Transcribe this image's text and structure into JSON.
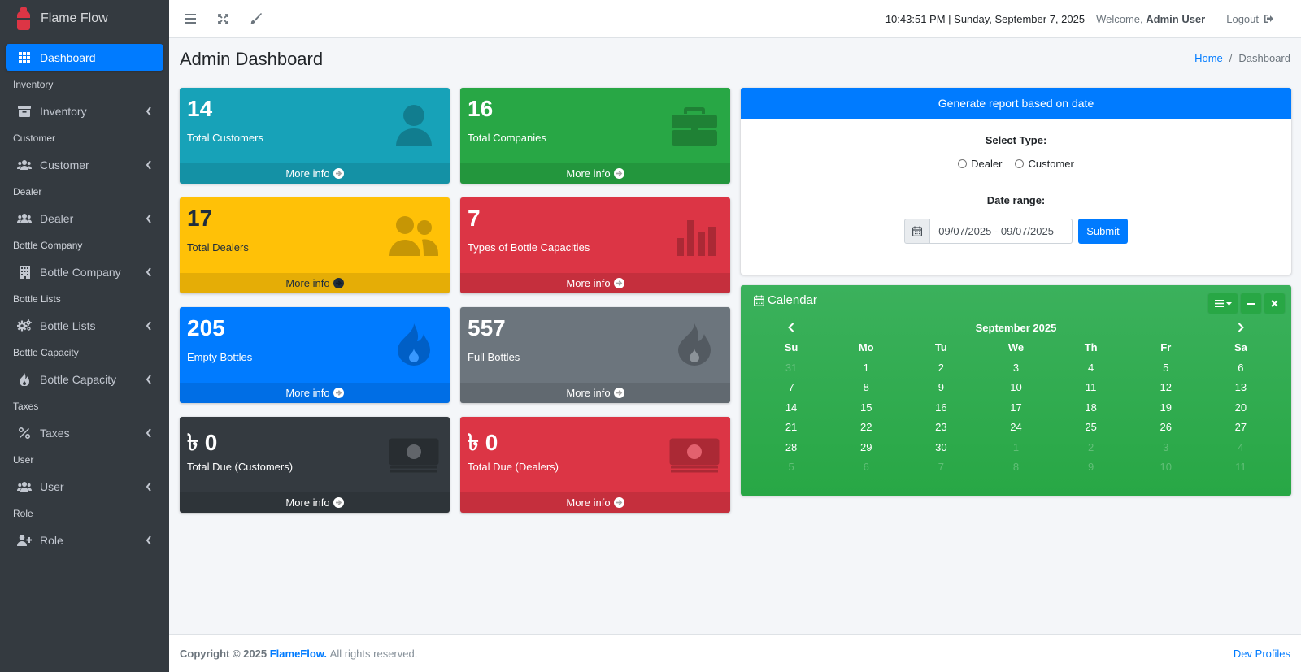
{
  "app": {
    "name": "Flame Flow"
  },
  "sidebar": {
    "active": {
      "label": "Dashboard"
    },
    "sections": [
      {
        "header": "Inventory",
        "label": "Inventory",
        "icon": "archive-icon"
      },
      {
        "header": "Customer",
        "label": "Customer",
        "icon": "users-icon"
      },
      {
        "header": "Dealer",
        "label": "Dealer",
        "icon": "users-icon"
      },
      {
        "header": "Bottle Company",
        "label": "Bottle Company",
        "icon": "building-icon"
      },
      {
        "header": "Bottle Lists",
        "label": "Bottle Lists",
        "icon": "cogs-icon"
      },
      {
        "header": "Bottle Capacity",
        "label": "Bottle Capacity",
        "icon": "fire-icon"
      },
      {
        "header": "Taxes",
        "label": "Taxes",
        "icon": "percent-icon"
      },
      {
        "header": "User",
        "label": "User",
        "icon": "users-icon"
      },
      {
        "header": "Role",
        "label": "Role",
        "icon": "user-plus-icon"
      }
    ]
  },
  "topbar": {
    "datetime": "10:43:51 PM | Sunday, September 7, 2025",
    "welcome_prefix": "Welcome,",
    "welcome_user": "Admin User",
    "logout": "Logout"
  },
  "page": {
    "title": "Admin Dashboard",
    "breadcrumb": {
      "home": "Home",
      "sep": "/",
      "current": "Dashboard"
    }
  },
  "boxes": [
    {
      "value": "14",
      "label": "Total Customers",
      "more": "More info",
      "color": "#17a2b8",
      "icon": "user-icon"
    },
    {
      "value": "16",
      "label": "Total Companies",
      "more": "More info",
      "color": "#28a745",
      "icon": "briefcase-icon"
    },
    {
      "value": "17",
      "label": "Total Dealers",
      "more": "More info",
      "color": "#ffc107",
      "icon": "user-friends-icon"
    },
    {
      "value": "7",
      "label": "Types of Bottle Capacities",
      "more": "More info",
      "color": "#dc3545",
      "icon": "bar-chart-icon"
    },
    {
      "value": "205",
      "label": "Empty Bottles",
      "more": "More info",
      "color": "#007bff",
      "icon": "fire-icon"
    },
    {
      "value": "557",
      "label": "Full Bottles",
      "more": "More info",
      "color": "#6c757d",
      "icon": "fire-icon"
    },
    {
      "value": "৳ 0",
      "label": "Total Due (Customers)",
      "more": "More info",
      "color": "#343a40",
      "icon": "money-bill-icon"
    },
    {
      "value": "৳ 0",
      "label": "Total Due (Dealers)",
      "more": "More info",
      "color": "#dc3545",
      "icon": "money-bill-icon"
    }
  ],
  "report": {
    "title": "Generate report based on date",
    "select_type": "Select Type:",
    "options": [
      "Dealer",
      "Customer"
    ],
    "date_range_label": "Date range:",
    "date_range_value": "09/07/2025 - 09/07/2025",
    "submit": "Submit"
  },
  "calendar": {
    "title": "Calendar",
    "month": "September 2025",
    "weekdays": [
      "Su",
      "Mo",
      "Tu",
      "We",
      "Th",
      "Fr",
      "Sa"
    ],
    "weeks": [
      [
        [
          "31",
          1
        ],
        [
          "1",
          0
        ],
        [
          "2",
          0
        ],
        [
          "3",
          0
        ],
        [
          "4",
          0
        ],
        [
          "5",
          0
        ],
        [
          "6",
          0
        ]
      ],
      [
        [
          "7",
          0
        ],
        [
          "8",
          0
        ],
        [
          "9",
          0
        ],
        [
          "10",
          0
        ],
        [
          "11",
          0
        ],
        [
          "12",
          0
        ],
        [
          "13",
          0
        ]
      ],
      [
        [
          "14",
          0
        ],
        [
          "15",
          0
        ],
        [
          "16",
          0
        ],
        [
          "17",
          0
        ],
        [
          "18",
          0
        ],
        [
          "19",
          0
        ],
        [
          "20",
          0
        ]
      ],
      [
        [
          "21",
          0
        ],
        [
          "22",
          0
        ],
        [
          "23",
          0
        ],
        [
          "24",
          0
        ],
        [
          "25",
          0
        ],
        [
          "26",
          0
        ],
        [
          "27",
          0
        ]
      ],
      [
        [
          "28",
          0
        ],
        [
          "29",
          0
        ],
        [
          "30",
          0
        ],
        [
          "1",
          1
        ],
        [
          "2",
          1
        ],
        [
          "3",
          1
        ],
        [
          "4",
          1
        ]
      ],
      [
        [
          "5",
          1
        ],
        [
          "6",
          1
        ],
        [
          "7",
          1
        ],
        [
          "8",
          1
        ],
        [
          "9",
          1
        ],
        [
          "10",
          1
        ],
        [
          "11",
          1
        ]
      ]
    ]
  },
  "footer": {
    "copyright_prefix": "Copyright © 2025",
    "brand": "FlameFlow.",
    "rights": "All rights reserved.",
    "right_link": "Dev Profiles"
  }
}
